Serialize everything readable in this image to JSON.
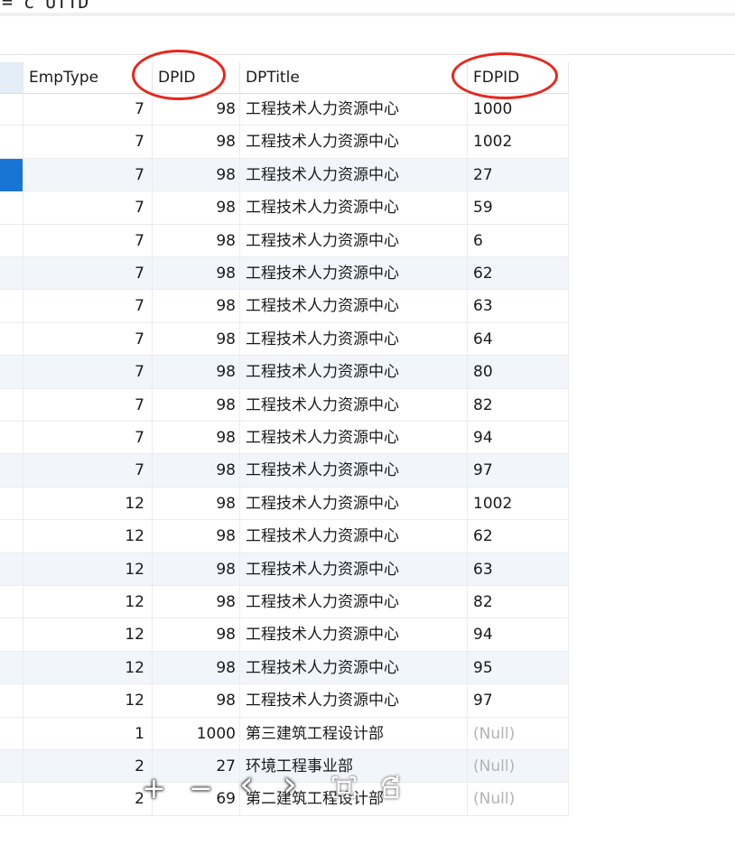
{
  "sql_line": "= c UTTD",
  "columns": {
    "emp_type": "EmpType",
    "dpid": "DPID",
    "dp_title": "DPTitle",
    "fdpid": "FDPID"
  },
  "rows": [
    {
      "emp": "7",
      "dpid": "98",
      "title": "工程技术人力资源中心",
      "fdpid": "1000",
      "selected": false,
      "alt": false
    },
    {
      "emp": "7",
      "dpid": "98",
      "title": "工程技术人力资源中心",
      "fdpid": "1002",
      "selected": false,
      "alt": false
    },
    {
      "emp": "7",
      "dpid": "98",
      "title": "工程技术人力资源中心",
      "fdpid": "27",
      "selected": true,
      "alt": true
    },
    {
      "emp": "7",
      "dpid": "98",
      "title": "工程技术人力资源中心",
      "fdpid": "59",
      "selected": false,
      "alt": false
    },
    {
      "emp": "7",
      "dpid": "98",
      "title": "工程技术人力资源中心",
      "fdpid": "6",
      "selected": false,
      "alt": false
    },
    {
      "emp": "7",
      "dpid": "98",
      "title": "工程技术人力资源中心",
      "fdpid": "62",
      "selected": false,
      "alt": true
    },
    {
      "emp": "7",
      "dpid": "98",
      "title": "工程技术人力资源中心",
      "fdpid": "63",
      "selected": false,
      "alt": false
    },
    {
      "emp": "7",
      "dpid": "98",
      "title": "工程技术人力资源中心",
      "fdpid": "64",
      "selected": false,
      "alt": false
    },
    {
      "emp": "7",
      "dpid": "98",
      "title": "工程技术人力资源中心",
      "fdpid": "80",
      "selected": false,
      "alt": true
    },
    {
      "emp": "7",
      "dpid": "98",
      "title": "工程技术人力资源中心",
      "fdpid": "82",
      "selected": false,
      "alt": false
    },
    {
      "emp": "7",
      "dpid": "98",
      "title": "工程技术人力资源中心",
      "fdpid": "94",
      "selected": false,
      "alt": false
    },
    {
      "emp": "7",
      "dpid": "98",
      "title": "工程技术人力资源中心",
      "fdpid": "97",
      "selected": false,
      "alt": true
    },
    {
      "emp": "12",
      "dpid": "98",
      "title": "工程技术人力资源中心",
      "fdpid": "1002",
      "selected": false,
      "alt": false
    },
    {
      "emp": "12",
      "dpid": "98",
      "title": "工程技术人力资源中心",
      "fdpid": "62",
      "selected": false,
      "alt": false
    },
    {
      "emp": "12",
      "dpid": "98",
      "title": "工程技术人力资源中心",
      "fdpid": "63",
      "selected": false,
      "alt": true
    },
    {
      "emp": "12",
      "dpid": "98",
      "title": "工程技术人力资源中心",
      "fdpid": "82",
      "selected": false,
      "alt": false
    },
    {
      "emp": "12",
      "dpid": "98",
      "title": "工程技术人力资源中心",
      "fdpid": "94",
      "selected": false,
      "alt": false
    },
    {
      "emp": "12",
      "dpid": "98",
      "title": "工程技术人力资源中心",
      "fdpid": "95",
      "selected": false,
      "alt": true
    },
    {
      "emp": "12",
      "dpid": "98",
      "title": "工程技术人力资源中心",
      "fdpid": "97",
      "selected": false,
      "alt": false
    },
    {
      "emp": "1",
      "dpid": "1000",
      "title": "第三建筑工程设计部",
      "fdpid": "(Null)",
      "selected": false,
      "alt": false
    },
    {
      "emp": "2",
      "dpid": "27",
      "title": "环境工程事业部",
      "fdpid": "(Null)",
      "selected": false,
      "alt": true
    },
    {
      "emp": "2",
      "dpid": "69",
      "title": "第二建筑工程设计部",
      "fdpid": "(Null)",
      "selected": false,
      "alt": false
    }
  ],
  "colors": {
    "selection": "#1875d6",
    "annotation_circle": "#e8261c",
    "header_highlight": "#e3eef9",
    "alt_row": "#f2f6fb",
    "null_text": "#b3b3b3"
  },
  "overlay_controls": {
    "zoom_in": "+",
    "zoom_out": "−",
    "prev": "‹",
    "next": "›"
  },
  "icons": [
    "zoom-in-icon",
    "zoom-out-icon",
    "previous-icon",
    "next-icon",
    "fit-screen-icon",
    "rotate-icon"
  ]
}
